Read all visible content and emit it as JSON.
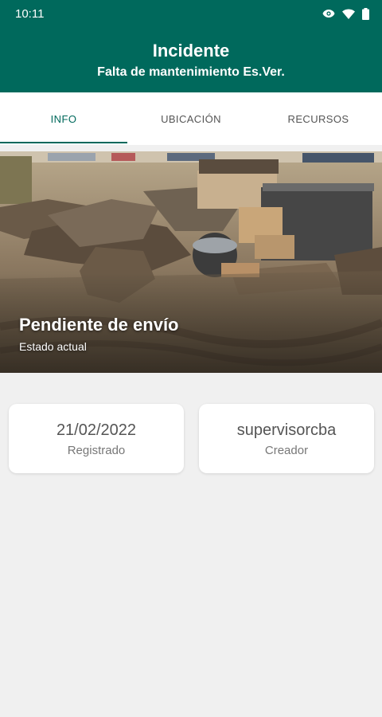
{
  "status_bar": {
    "time": "10:11",
    "icons": [
      "eye-icon",
      "wifi-icon",
      "battery-icon"
    ]
  },
  "header": {
    "title": "Incidente",
    "subtitle": "Falta de mantenimiento Es.Ver."
  },
  "tabs": [
    {
      "label": "INFO",
      "active": true
    },
    {
      "label": "UBICACIÓN",
      "active": false
    },
    {
      "label": "RECURSOS",
      "active": false
    }
  ],
  "hero": {
    "status": "Pendiente de envío",
    "status_label": "Estado actual"
  },
  "cards": [
    {
      "value": "21/02/2022",
      "label": "Registrado"
    },
    {
      "value": "supervisorcba",
      "label": "Creador"
    }
  ],
  "colors": {
    "primary": "#00695c",
    "background": "#f0f0f0",
    "card": "#ffffff"
  }
}
